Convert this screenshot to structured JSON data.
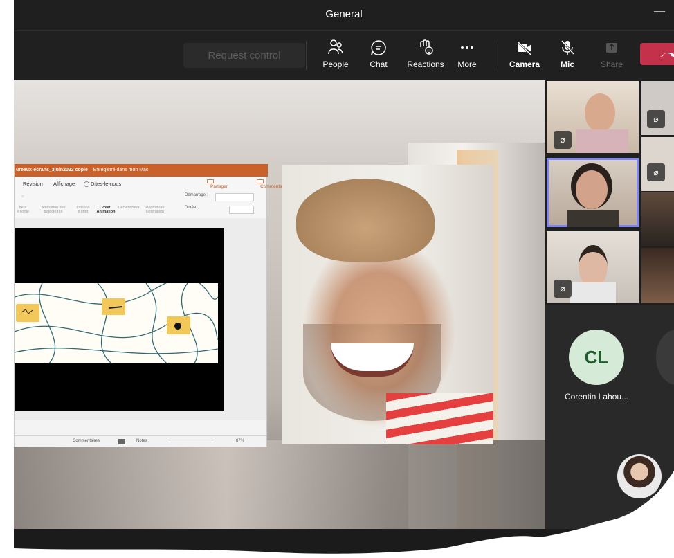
{
  "window": {
    "title": "General"
  },
  "toolbar": {
    "request_control": "Request control",
    "people": "People",
    "chat": "Chat",
    "reactions": "Reactions",
    "more": "More",
    "camera": "Camera",
    "mic": "Mic",
    "share": "Share"
  },
  "ppt": {
    "title_bold": "ureaux-écrans_3juin2022 copie",
    "title_rest": " _ Enregistré dans mon Mac",
    "menu_revision": "Révision",
    "menu_affichage": "Affichage",
    "menu_dites": "Dites-le-nous",
    "partager": "Partager",
    "commentaires": "Commentaires",
    "ribbon_effets": "ffets",
    "ribbon_sortie": "e sortie",
    "ribbon_animation_des": "Animation des",
    "ribbon_trajectoires": "trajectoires",
    "ribbon_options": "Options",
    "ribbon_deffet": "d'effet",
    "ribbon_volet": "Volet",
    "ribbon_animation": "Animation",
    "ribbon_declencheur": "Déclencheur",
    "ribbon_reproduire": "Reproduire",
    "ribbon_lanimation": "l'animation",
    "demarrage": "Démarrage :",
    "duree": "Durée :",
    "status_notes": "Notes",
    "status_commentaires": "Commentaires",
    "zoom": "87%"
  },
  "participants": {
    "cl_initials": "CL",
    "cl_name": "Corentin Lahou..."
  },
  "colors": {
    "accent": "#7f85f5",
    "hangup": "#c4314b",
    "ppt_orange": "#c9612a",
    "avatar_bg": "#d5ebd8"
  },
  "icons": [
    "people-icon",
    "chat-icon",
    "reactions-icon",
    "more-icon",
    "camera-off-icon",
    "mic-off-icon",
    "share-icon",
    "hangup-icon",
    "minimize-icon"
  ]
}
